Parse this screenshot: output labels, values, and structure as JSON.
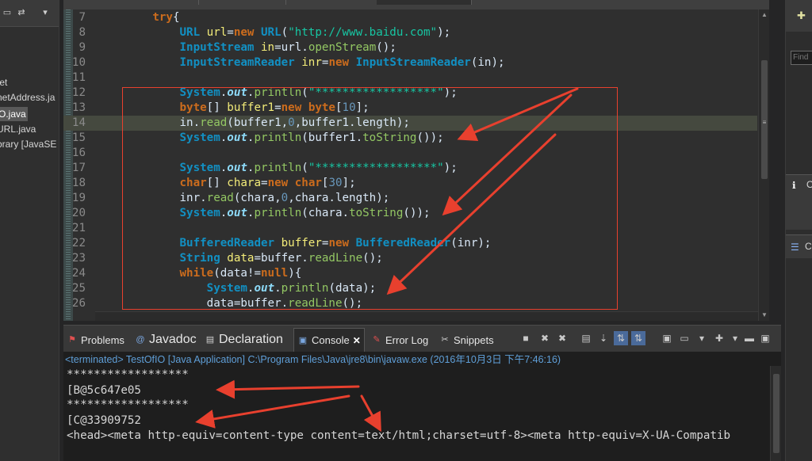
{
  "code": {
    "lines": [
      {
        "n": "7",
        "html": "        <span class='kw'>try</span>{"
      },
      {
        "n": "8",
        "html": "            <span class='ty'>URL</span> <span class='vr'>url</span>=<span class='kw'>new</span> <span class='ty'>URL</span>(<span class='st'>\"http://www.baidu.com\"</span>);"
      },
      {
        "n": "9",
        "html": "            <span class='ty'>InputStream</span> <span class='vr'>in</span>=url.<span class='me'>openStream</span>();"
      },
      {
        "n": "10",
        "html": "            <span class='ty'>InputStreamReader</span> <span class='vr'>inr</span>=<span class='kw'>new</span> <span class='ty'>InputStreamReader</span>(in);"
      },
      {
        "n": "11",
        "html": ""
      },
      {
        "n": "12",
        "html": "            <span class='ty'>System</span>.<span class='fi'>out</span>.<span class='me'>println</span>(<span class='st'>\"******************\"</span>);"
      },
      {
        "n": "13",
        "html": "            <span class='kw'>byte</span>[] <span class='vr'>buffer1</span>=<span class='kw'>new</span> <span class='kw'>byte</span>[<span class='nu'>10</span>];"
      },
      {
        "n": "14",
        "html": "            in.<span class='me'>read</span>(buffer1,<span class='nu'>0</span>,buffer1.length);",
        "cur": true
      },
      {
        "n": "15",
        "html": "            <span class='ty'>System</span>.<span class='fi'>out</span>.<span class='me'>println</span>(buffer1.<span class='me'>toString</span>());"
      },
      {
        "n": "16",
        "html": ""
      },
      {
        "n": "17",
        "html": "            <span class='ty'>System</span>.<span class='fi'>out</span>.<span class='me'>println</span>(<span class='st'>\"******************\"</span>);"
      },
      {
        "n": "18",
        "html": "            <span class='kw'>char</span>[] <span class='vr'>chara</span>=<span class='kw'>new</span> <span class='kw'>char</span>[<span class='nu'>30</span>];"
      },
      {
        "n": "19",
        "html": "            inr.<span class='me'>read</span>(chara,<span class='nu'>0</span>,chara.length);"
      },
      {
        "n": "20",
        "html": "            <span class='ty'>System</span>.<span class='fi'>out</span>.<span class='me'>println</span>(chara.<span class='me'>toString</span>());"
      },
      {
        "n": "21",
        "html": ""
      },
      {
        "n": "22",
        "html": "            <span class='ty'>BufferedReader</span> <span class='vr'>buffer</span>=<span class='kw'>new</span> <span class='ty'>BufferedReader</span>(inr);"
      },
      {
        "n": "23",
        "html": "            <span class='ty'>String</span> <span class='vr'>data</span>=buffer.<span class='me'>readLine</span>();"
      },
      {
        "n": "24",
        "html": "            <span class='kw'>while</span>(data!=<span class='kw'>null</span>){"
      },
      {
        "n": "25",
        "html": "                <span class='ty'>System</span>.<span class='fi'>out</span>.<span class='me'>println</span>(data);"
      },
      {
        "n": "26",
        "html": "                data=buffer.<span class='me'>readLine</span>();"
      }
    ]
  },
  "explorer": {
    "items": [
      {
        "label": "tet",
        "sel": false
      },
      {
        "label": "netAddress.ja",
        "sel": false
      },
      {
        "label": "O.java",
        "sel": true
      },
      {
        "label": "URL.java",
        "sel": false
      },
      {
        "label": "brary [JavaSE",
        "sel": false
      }
    ]
  },
  "tabs": {
    "problems": "Problems",
    "javadoc": "Javadoc",
    "declaration": "Declaration",
    "console": "Console",
    "errorlog": "Error Log",
    "snippets": "Snippets"
  },
  "console": {
    "terminated": "<terminated> TestOfIO [Java Application] C:\\Program Files\\Java\\jre8\\bin\\javaw.exe (2016年10月3日 下午7:46:16)",
    "lines": [
      "******************",
      "[B@5c647e05",
      "******************",
      "[C@33909752",
      "<head><meta http-equiv=content-type content=text/html;charset=utf-8><meta http-equiv=X-UA-Compatib"
    ]
  },
  "right": {
    "input_placeholder": "Find",
    "label1": "O",
    "label2": "C"
  },
  "colors": {
    "annotation": "#e8402e",
    "keyword": "#cc6c1d",
    "type": "#1290c3",
    "string": "#17c6a3"
  }
}
